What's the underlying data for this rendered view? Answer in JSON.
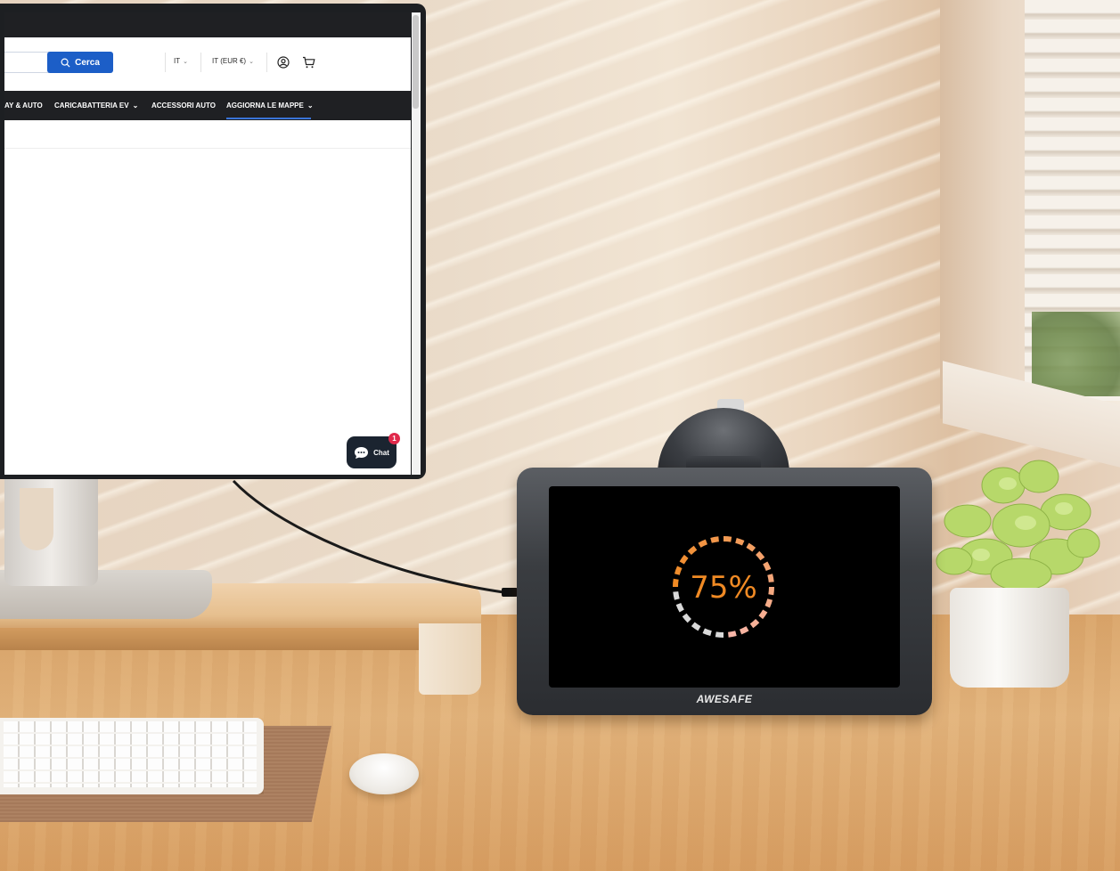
{
  "browser": {
    "search_button_label": "Cerca",
    "language": "IT",
    "currency": "IT (EUR €)",
    "nav_items": [
      {
        "label": "AY & AUTO",
        "has_dropdown": false
      },
      {
        "label": "CARICABATTERIA EV",
        "has_dropdown": true
      },
      {
        "label": "ACCESSORI AUTO",
        "has_dropdown": false
      },
      {
        "label": "AGGIORNA LE MAPPE",
        "has_dropdown": true,
        "active": true
      }
    ],
    "chat_label": "Chat",
    "chat_badge_count": "1",
    "accent_color": "#1c5ec7",
    "nav_bg_color": "#1f2023"
  },
  "gps_device": {
    "progress_text": "75%",
    "progress_value": 0.75,
    "brand_logo": "AWESAFE",
    "progress_color_start": "#f08a24",
    "progress_color_end": "#f7b6a8",
    "progress_track_color": "#d9d9d9"
  },
  "icons": [
    "search-icon",
    "account-icon",
    "cart-icon",
    "chat-icon",
    "chevron-down-icon"
  ]
}
